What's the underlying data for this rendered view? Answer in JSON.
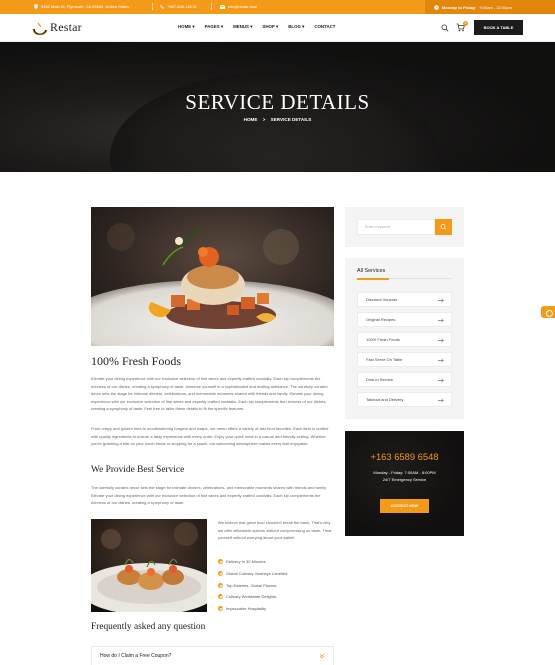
{
  "topbar": {
    "address": "9462 Main St, Plymouth, CA 95669, United States",
    "phone": "+987-626-16015",
    "email": "info@restar.com",
    "hours_label": "Monday to Friday:",
    "hours_value": "9:00am - 22:00pm"
  },
  "header": {
    "logo_text": "Restar",
    "nav": [
      {
        "label": "HOME",
        "has_dropdown": true
      },
      {
        "label": "PAGES",
        "has_dropdown": true
      },
      {
        "label": "MENUS",
        "has_dropdown": true
      },
      {
        "label": "SHOP",
        "has_dropdown": true
      },
      {
        "label": "BLOG",
        "has_dropdown": true
      },
      {
        "label": "CONTACT",
        "has_dropdown": false
      }
    ],
    "cart_count": "0",
    "book_label": "BOOK A TABLE"
  },
  "hero": {
    "title": "SERVICE DETAILS",
    "crumb_home": "HOME",
    "crumb_sep": ">",
    "crumb_current": "SERVICE DETAILS"
  },
  "main": {
    "heading": "100% Fresh Foods",
    "para1": "Elevate your dining experience with our exclusive selection of fine wines and expertly crafted cocktails. Each sip complements the richness of our dishes, creating a symphony of taste. Immerse yourself in a sophisticated and inviting ambiance. The carefully curated decor sets the stage for intimate dinners, celebrations, and memorable moments shared with friends and family. Elevate your dining experience with our exclusive selection of fine wines and expertly crafted cocktails. Each sip complements the richness of our dishes, creating a symphony of taste. Feel free to tailor these details to fit the specific features.",
    "para2": "From crispy and golden fries to mouthwatering burgers and wraps, our menu offers a variety of fast food favorites. Each item is crafted with quality ingredients to ensure a tasty experience with every order. Enjoy your quick meal in a casual and friendly setting. Whether you're grabbing a bite on your lunch break or stopping for a snack, our welcoming atmosphere makes every visit enjoyable.",
    "subheading": "We Provide Best Service",
    "para3": "The carefully curated decor sets the stage for intimate dinners, celebrations, and memorable moments shared with friends and family. Elevate your dining experience with our exclusive selection of fine wines and expertly crafted cocktails. Each sip complements the richness of our dishes, creating a symphony of taste.",
    "para4": "We believe that great food shouldn't break the bank. That's why we offer affordable options without compromising on taste. Treat yourself without worrying about your wallet!",
    "checklist": [
      "Delivery In 30 Minutes",
      "Global Culinary Journeys Unveiled.",
      "Top Eateries, Global Flavors.",
      "Culinary Worldwide Delights.",
      "Impeccable Hospitality"
    ],
    "faq_heading": "Frequently asked any question",
    "faq_first": "How do I Claim a Free Coupon?"
  },
  "sidebar": {
    "search_placeholder": "Enter Keyword",
    "services_title": "All Services",
    "services": [
      "Discount Voucher",
      "Original Recipes",
      "100% Fresh Foods",
      "Fast Serve On Table",
      "Dine-in Service",
      "Takeout and Delivery"
    ],
    "phone": "+163 6589 6548",
    "hours": "Monday - Friday: 7:00AM - 8:00PM",
    "emergency": "24/7 Emergency Service",
    "contact_label": "CONTACT NOW"
  },
  "colors": {
    "accent": "#f39a19",
    "dark": "#1c1c1c"
  },
  "icons": {
    "topbar": [
      "location-icon",
      "phone-icon",
      "mail-icon",
      "clock-icon"
    ],
    "header": [
      "search-icon",
      "cart-icon"
    ],
    "list": [
      "arrow-right-icon",
      "check-icon",
      "chevron-down-icon"
    ]
  }
}
